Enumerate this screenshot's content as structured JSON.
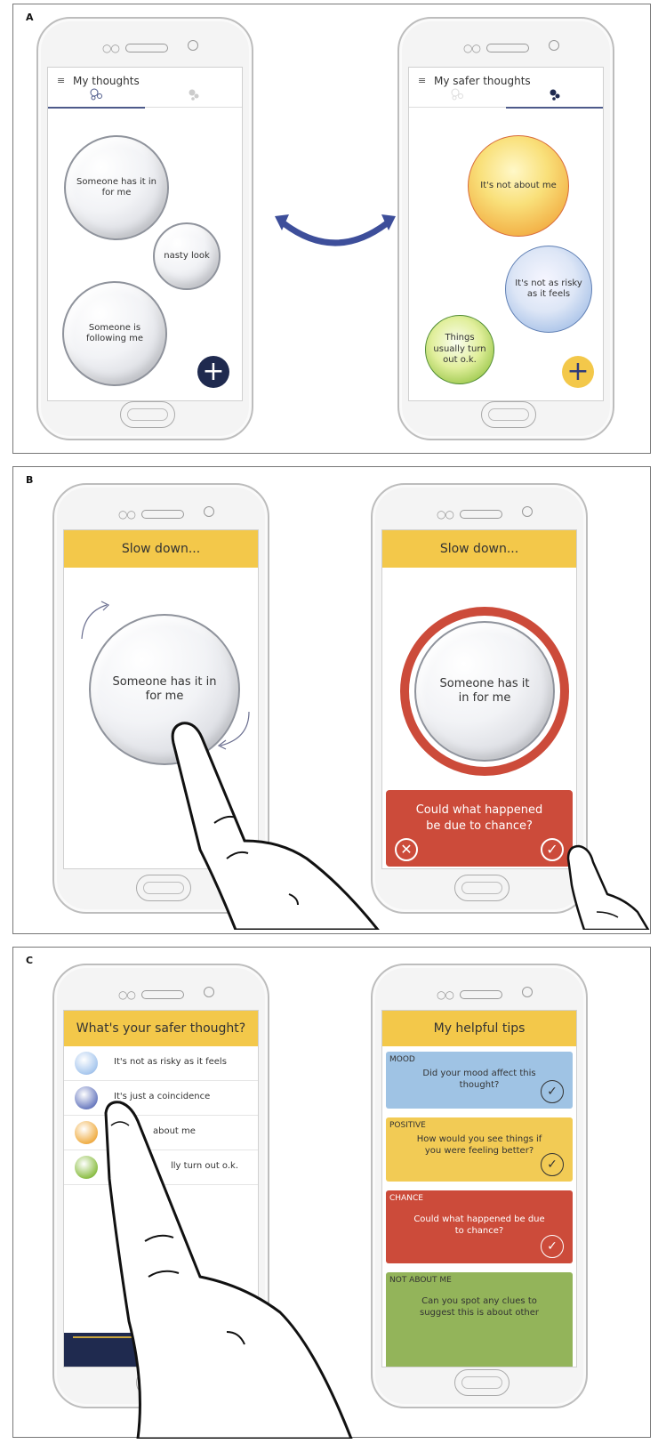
{
  "panels": {
    "a": {
      "label": "A"
    },
    "b": {
      "label": "B"
    },
    "c": {
      "label": "C"
    }
  },
  "panel_a": {
    "left_phone": {
      "title": "My thoughts",
      "menu_icon": "menu-icon",
      "tab_icons": [
        "bubbles-outline-icon",
        "bubbles-filled-icon"
      ],
      "bubbles": [
        "Someone has it in for me",
        "nasty look",
        "Someone is following me"
      ],
      "fab_label": "+",
      "fab_color": "#1f2a4f"
    },
    "right_phone": {
      "title": "My safer thoughts",
      "bubbles": [
        "It's not about me",
        "It's not as risky as it feels",
        "Things usually turn out o.k."
      ],
      "fab_label": "+",
      "fab_color": "#f3c84a"
    },
    "swap_arrow": "double-arrow-icon"
  },
  "panel_b": {
    "left_phone": {
      "header": "Slow down...",
      "bubble_text": "Someone has it in for me"
    },
    "right_phone": {
      "header": "Slow down...",
      "bubble_text": "Someone has it in for me",
      "question": "Could what happened be due to chance?",
      "reject_icon": "close-circle-icon",
      "accept_icon": "check-circle-icon"
    }
  },
  "panel_c": {
    "left_phone": {
      "header": "What's your safer thought?",
      "items": [
        {
          "text": "It's not as risky as it feels",
          "color": "#a9c8ee"
        },
        {
          "text": "It's just a coincidence",
          "color": "#6f7fc2"
        },
        {
          "text": "about me",
          "color": "#f0b04a"
        },
        {
          "text": "lly turn out o.k.",
          "color": "#8fc04a"
        }
      ]
    },
    "right_phone": {
      "header": "My helpful tips",
      "tips": [
        {
          "category": "MOOD",
          "question": "Did your mood affect this thought?",
          "color": "#9fc3e4"
        },
        {
          "category": "POSITIVE",
          "question": "How would you see things if you were feeling better?",
          "color": "#f2cb55"
        },
        {
          "category": "CHANCE",
          "question": "Could what happened be due to chance?",
          "color": "#cc4b3a"
        },
        {
          "category": "NOT ABOUT ME",
          "question": "Can you spot any clues to suggest this is about other",
          "color": "#93b45a"
        }
      ]
    }
  }
}
